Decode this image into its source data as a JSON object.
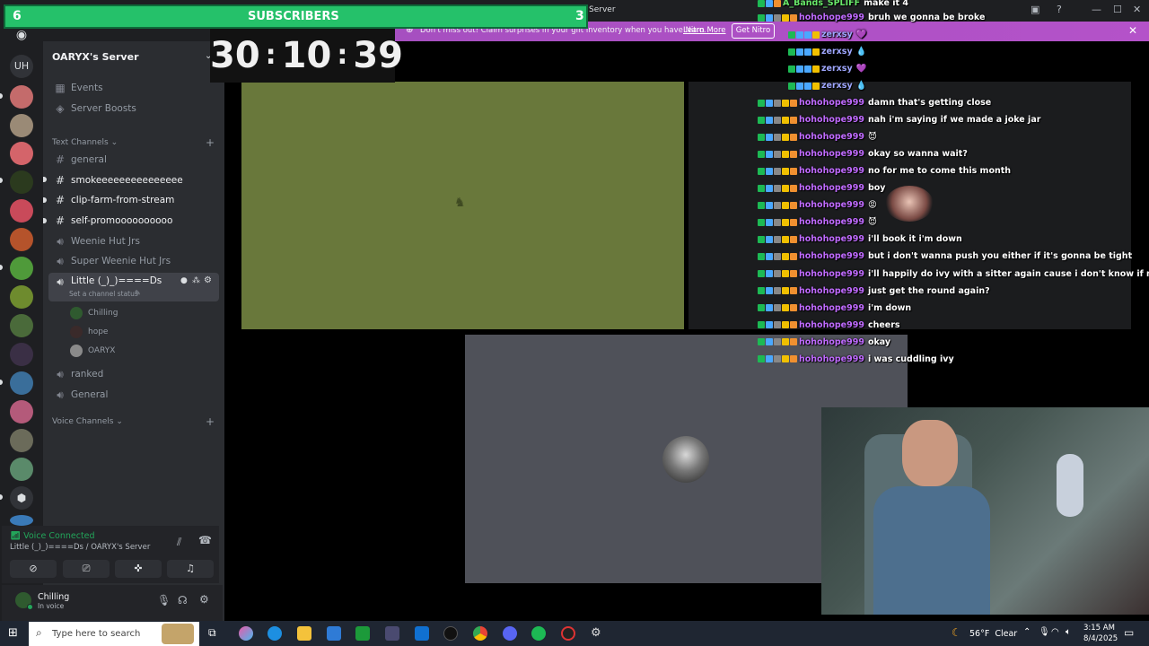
{
  "window": {
    "title_fragment": "Server"
  },
  "subscribers": {
    "left_count": "6",
    "label": "SUBSCRIBERS",
    "right_count": "3"
  },
  "timer": {
    "value": "30:10:39"
  },
  "nitro_banner": {
    "text": "Don't miss out! Claim surprises in your gift inventory when you have Nitro.",
    "link": "Learn More",
    "button": "Get Nitro"
  },
  "rail": {
    "dm_label": "UH"
  },
  "server": {
    "name": "OARYX's Server"
  },
  "sidebar": {
    "top_items": [
      {
        "label": "Events"
      },
      {
        "label": "Server Boosts"
      }
    ],
    "text_category": "Text Channels",
    "channels": [
      {
        "label": "general",
        "bold": false
      },
      {
        "label": "smokeeeeeeeeeeeeeee",
        "bold": true
      },
      {
        "label": "clip-farm-from-stream",
        "bold": true
      },
      {
        "label": "self-promoooooooooo",
        "bold": true
      },
      {
        "label": "Weenie Hut Jrs",
        "bold": false
      },
      {
        "label": "Super Weenie Hut Jrs",
        "bold": false
      },
      {
        "label": "Little (_)_)====Ds",
        "bold": true
      }
    ],
    "channel_status": "Set a channel status",
    "voice_users": [
      "Chilling",
      "hope",
      "OARYX"
    ],
    "more_channels": [
      {
        "label": "ranked"
      },
      {
        "label": "General"
      }
    ],
    "voice_category": "Voice Channels"
  },
  "voice_panel": {
    "status": "Voice Connected",
    "location": "Little (_)_)====Ds / OARYX's Server"
  },
  "user_panel": {
    "name": "Chilling",
    "status": "In voice"
  },
  "chat": [
    {
      "user": "A_Bands_SPLIFF",
      "msg": "make it 4",
      "color": "green"
    },
    {
      "user": "hohohope999",
      "msg": "bruh we gonna be broke",
      "color": "purple"
    },
    {
      "user": "zerxsy",
      "msg": "💜",
      "color": "blue"
    },
    {
      "user": "zerxsy",
      "msg": "💧",
      "color": "blue"
    },
    {
      "user": "zerxsy",
      "msg": "💜",
      "color": "blue"
    },
    {
      "user": "zerxsy",
      "msg": "💧",
      "color": "blue"
    },
    {
      "user": "hohohope999",
      "msg": "damn that's getting close",
      "color": "purple"
    },
    {
      "user": "hohohope999",
      "msg": "nah i'm saying if we made a joke jar",
      "color": "purple"
    },
    {
      "user": "hohohope999",
      "msg": "😈",
      "color": "purple"
    },
    {
      "user": "hohohope999",
      "msg": "okay so wanna wait?",
      "color": "purple"
    },
    {
      "user": "hohohope999",
      "msg": "no for me to come this month",
      "color": "purple"
    },
    {
      "user": "hohohope999",
      "msg": "boy",
      "color": "purple"
    },
    {
      "user": "hohohope999",
      "msg": "😡",
      "color": "purple"
    },
    {
      "user": "hohohope999",
      "msg": "😈",
      "color": "purple"
    },
    {
      "user": "hohohope999",
      "msg": "i'll book it i'm down",
      "color": "purple"
    },
    {
      "user": "hohohope999",
      "msg": "but i don't wanna push you either if it's gonna be tight",
      "color": "purple"
    },
    {
      "user": "hohohope999",
      "msg": "i'll happily do ivy with a sitter again cause i don't know if my aunt gon",
      "color": "purple"
    },
    {
      "user": "hohohope999",
      "msg": "just get the round again?",
      "color": "purple"
    },
    {
      "user": "hohohope999",
      "msg": "i'm down",
      "color": "purple"
    },
    {
      "user": "hohohope999",
      "msg": "cheers",
      "color": "purple"
    },
    {
      "user": "hohohope999",
      "msg": "okay",
      "color": "purple"
    },
    {
      "user": "hohohope999",
      "msg": "i was cuddling ivy",
      "color": "purple"
    }
  ],
  "taskbar": {
    "search_placeholder": "Type here to search",
    "weather": "56°F  Clear",
    "time": "3:15 AM",
    "date": "8/4/2025"
  },
  "colors": {
    "accent": "#5865f2",
    "voice_green": "#23a55a",
    "subbar_green": "#25c16a",
    "tile_green": "#69783b",
    "chat_purple": "#c06bff"
  }
}
